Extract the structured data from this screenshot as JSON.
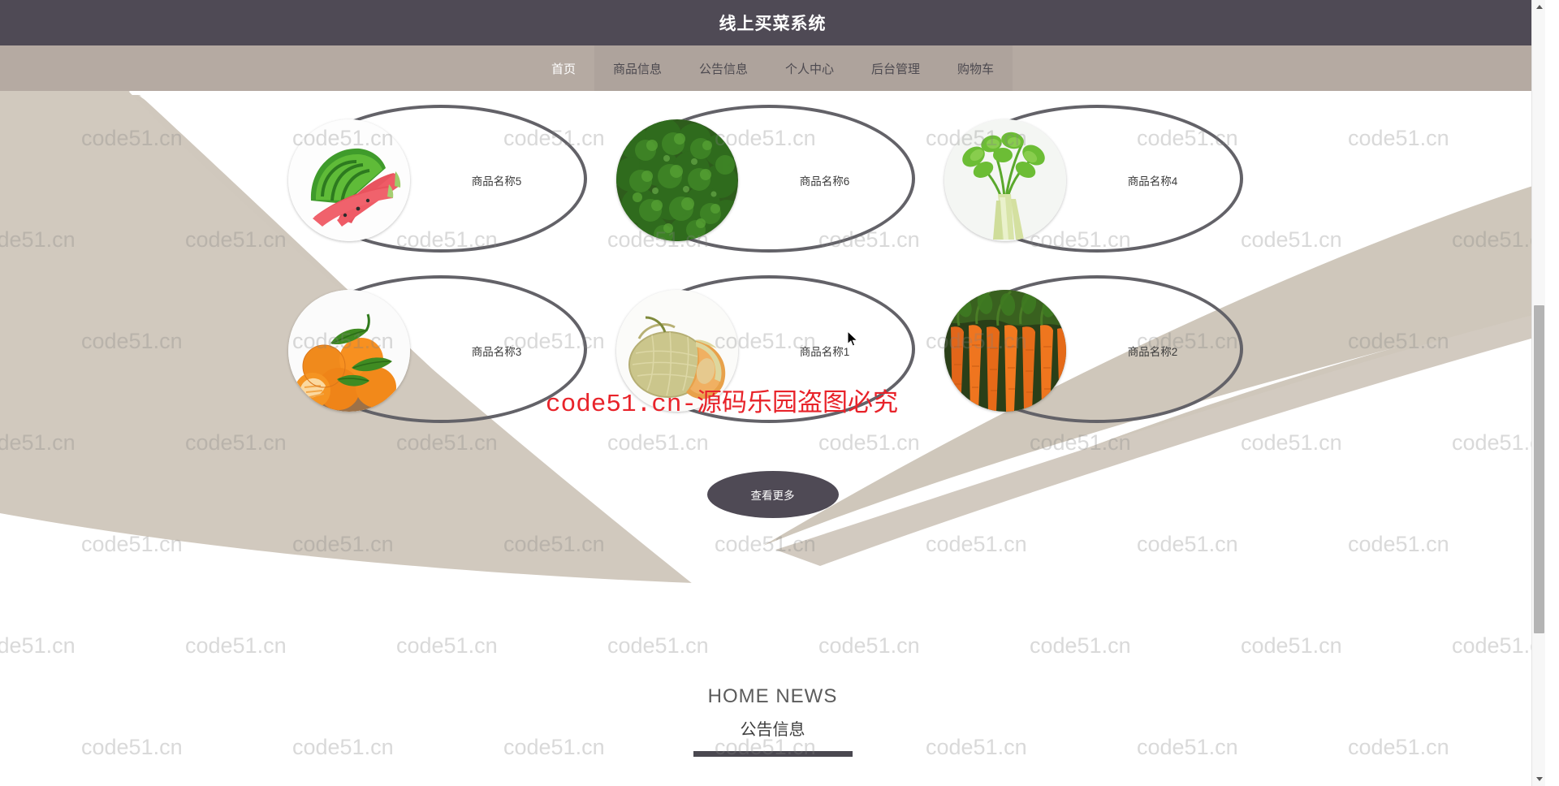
{
  "header": {
    "title": "线上买菜系统",
    "bg_color": "#4f4a55",
    "text_color": "#ffffff"
  },
  "nav": {
    "bg_color": "#b5aaa2",
    "active_color": "#ffffff",
    "items": [
      {
        "label": "首页",
        "active": true
      },
      {
        "label": "商品信息",
        "active": false
      },
      {
        "label": "公告信息",
        "active": false
      },
      {
        "label": "个人中心",
        "active": false
      },
      {
        "label": "后台管理",
        "active": false
      },
      {
        "label": "购物车",
        "active": false
      }
    ]
  },
  "products": {
    "items": [
      {
        "name": "商品名称5",
        "image": "watermelon"
      },
      {
        "name": "商品名称6",
        "image": "broccoli"
      },
      {
        "name": "商品名称4",
        "image": "celery"
      },
      {
        "name": "商品名称3",
        "image": "oranges"
      },
      {
        "name": "商品名称1",
        "image": "cantaloupe"
      },
      {
        "name": "商品名称2",
        "image": "carrots"
      }
    ],
    "more_button_label": "查看更多"
  },
  "news": {
    "title_en": "HOME NEWS",
    "title_cn": "公告信息",
    "underline_color": "#4a4850"
  },
  "watermarks": {
    "tile_text": "code51.cn",
    "red_text": "code51.cn-源码乐园盗图必究",
    "red_color": "#e8232a"
  },
  "scrollbar": {
    "up_arrow": "▲",
    "down_arrow": "▼"
  }
}
